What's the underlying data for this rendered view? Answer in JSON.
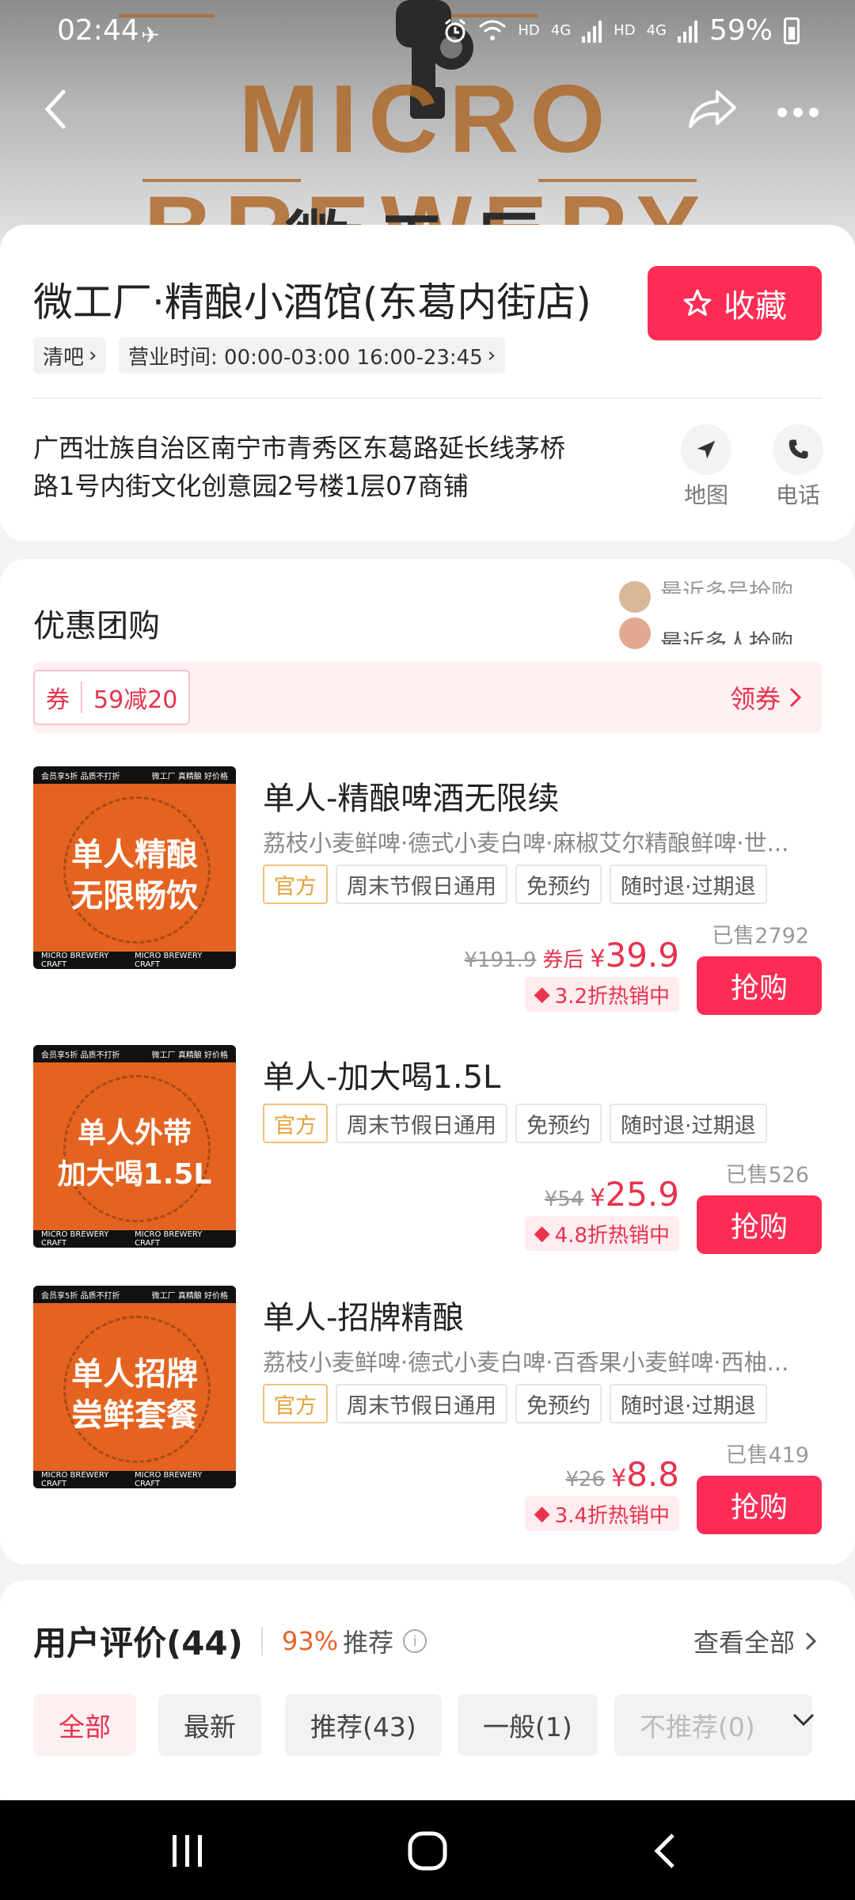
{
  "status_bar": {
    "time": "02:44",
    "hd1": "HD",
    "net1": "4G",
    "hd2": "HD",
    "net2": "4G",
    "battery": "59%"
  },
  "hero": {
    "logo_text": "MICRO BREWERY",
    "logo_cn": "微工厂"
  },
  "store": {
    "name": "微工厂·精酿小酒馆(东葛内街店)",
    "favorite_label": "收藏",
    "category": "清吧",
    "hours": "营业时间: 00:00-03:00 16:00-23:45",
    "address": "广西壮族自治区南宁市青秀区东葛路延长线茅桥路1号内街文化创意园2号楼1层07商铺",
    "map_label": "地图",
    "phone_label": "电话"
  },
  "deals_section": {
    "title": "优惠团购",
    "ticker_1": "最近多号抢购",
    "ticker_2": "最近多人抢购",
    "coupon": {
      "tag": "券",
      "value": "59减20",
      "action": "领券"
    },
    "items": [
      {
        "thumb_text_1": "单人精酿",
        "thumb_text_2": "无限畅饮",
        "band_top_left": "会员享5折 品质不打折",
        "band_top_right": "微工厂 真精酿 好价格",
        "band_bottom_left": "MICRO BREWERY CRAFT",
        "band_bottom_right": "MICRO BREWERY CRAFT",
        "name": "单人-精酿啤酒无限续",
        "desc": "荔枝小麦鲜啤·德式小麦白啤·麻椒艾尔精酿鲜啤·世...",
        "tags": [
          "官方",
          "周末节假日通用",
          "免预约",
          "随时退·过期退"
        ],
        "sold": "已售2792",
        "old_price": "¥191.9",
        "after_label": "券后",
        "currency": "¥",
        "price": "39.9",
        "hot": "3.2折热销中",
        "buy": "抢购"
      },
      {
        "thumb_text_1": "单人外带",
        "thumb_text_2": "加大喝1.5L",
        "band_top_left": "会员享5折 品质不打折",
        "band_top_right": "微工厂 真精酿 好价格",
        "band_bottom_left": "MICRO BREWERY CRAFT",
        "band_bottom_right": "MICRO BREWERY CRAFT",
        "name": "单人-加大喝1.5L",
        "tags": [
          "官方",
          "周末节假日通用",
          "免预约",
          "随时退·过期退"
        ],
        "sold": "已售526",
        "old_price": "¥54",
        "currency": "¥",
        "price": "25.9",
        "hot": "4.8折热销中",
        "buy": "抢购"
      },
      {
        "thumb_text_1": "单人招牌",
        "thumb_text_2": "尝鲜套餐",
        "band_top_left": "会员享5折 品质不打折",
        "band_top_right": "微工厂 真精酿 好价格",
        "band_bottom_left": "MICRO BREWERY CRAFT",
        "band_bottom_right": "MICRO BREWERY CRAFT",
        "name": "单人-招牌精酿",
        "desc": "荔枝小麦鲜啤·德式小麦白啤·百香果小麦鲜啤·西柚...",
        "tags": [
          "官方",
          "周末节假日通用",
          "免预约",
          "随时退·过期退"
        ],
        "sold": "已售419",
        "old_price": "¥26",
        "currency": "¥",
        "price": "8.8",
        "hot": "3.4折热销中",
        "buy": "抢购"
      }
    ]
  },
  "reviews": {
    "title": "用户评价(44)",
    "pct": "93%",
    "pct_label": "推荐",
    "info": "i",
    "view_all": "查看全部",
    "filters": [
      "全部",
      "最新",
      "推荐(43)",
      "一般(1)",
      "不推荐(0)"
    ]
  },
  "colors": {
    "accent": "#fe2c55",
    "price_red": "#e8324e",
    "thumb_orange": "#e56320"
  }
}
